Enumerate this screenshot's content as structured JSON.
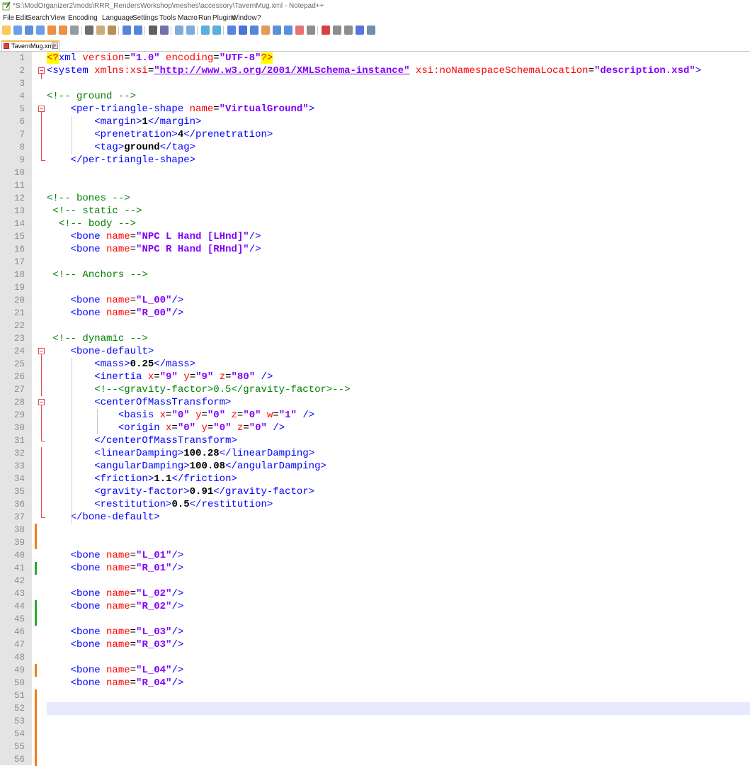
{
  "window": {
    "title": "*S:\\ModOrganizer2\\mods\\RRR_RendersWorkshop\\meshes\\accessory\\TavernMug.xml - Notepad++",
    "app_icon": "notepad-icon"
  },
  "menu": [
    "File",
    "Edit",
    "Search",
    "View",
    "Encoding",
    "Language",
    "Settings",
    "Tools",
    "Macro",
    "Run",
    "Plugins",
    "Window",
    "?"
  ],
  "toolbar": {
    "buttons": [
      "new-file-icon",
      "open-file-icon",
      "save-icon",
      "save-all-icon",
      "close-icon",
      "close-all-icon",
      "print-icon",
      "cut-icon",
      "copy-icon",
      "paste-icon",
      "undo-icon",
      "redo-icon",
      "find-icon",
      "replace-icon",
      "zoom-in-icon",
      "zoom-out-icon",
      "sync-vertical-icon",
      "sync-horizontal-icon",
      "word-wrap-icon",
      "show-all-chars-icon",
      "indent-guide-icon",
      "user-language-icon",
      "doc-map-icon",
      "function-list-icon",
      "folder-workspace-icon",
      "monitor-icon",
      "record-macro-icon",
      "stop-record-icon",
      "play-macro-icon",
      "run-macro-multiple-icon",
      "save-macro-icon"
    ]
  },
  "tabs": [
    {
      "label": "TavernMug.xml",
      "active": true,
      "modified": true
    }
  ],
  "editor": {
    "caret_line": 52,
    "line_numbers": [
      "1",
      "2",
      "3",
      "4",
      "5",
      "6",
      "7",
      "8",
      "9",
      "10",
      "11",
      "12",
      "13",
      "14",
      "15",
      "16",
      "17",
      "18",
      "19",
      "20",
      "21",
      "22",
      "23",
      "24",
      "25",
      "26",
      "27",
      "28",
      "29",
      "30",
      "31",
      "32",
      "33",
      "34",
      "35",
      "36",
      "37",
      "38",
      "39",
      "40",
      "41",
      "42",
      "43",
      "44",
      "45",
      "46",
      "47",
      "48",
      "49",
      "50",
      "51",
      "52",
      "53",
      "54",
      "55",
      "56"
    ],
    "lines": [
      [
        [
          "hl",
          "<?"
        ],
        [
          "tag",
          "xml "
        ],
        [
          "att",
          "version"
        ],
        [
          "eq",
          "="
        ],
        [
          "val",
          "\"1.0\""
        ],
        [
          "att",
          " encoding"
        ],
        [
          "eq",
          "="
        ],
        [
          "val",
          "\"UTF-8\""
        ],
        [
          "hl",
          "?>"
        ]
      ],
      [
        [
          "tag",
          "<system "
        ],
        [
          "att",
          "xmlns:xsi"
        ],
        [
          "eq",
          "="
        ],
        [
          "link",
          "\"http://www.w3.org/2001/XMLSchema-instance\""
        ],
        [
          "att",
          " xsi:noNamespaceSchemaLocation"
        ],
        [
          "eq",
          "="
        ],
        [
          "val",
          "\"description.xsd\""
        ],
        [
          "tag",
          ">"
        ]
      ],
      [],
      [
        [
          "cmt",
          "<!-- ground -->"
        ]
      ],
      [
        [
          "plain",
          "    "
        ],
        [
          "tag",
          "<per-triangle-shape "
        ],
        [
          "att",
          "name"
        ],
        [
          "eq",
          "="
        ],
        [
          "val",
          "\"VirtualGround\""
        ],
        [
          "tag",
          ">"
        ]
      ],
      [
        [
          "plain",
          "        "
        ],
        [
          "tag",
          "<margin>"
        ],
        [
          "txt",
          "1"
        ],
        [
          "tag",
          "</margin>"
        ]
      ],
      [
        [
          "plain",
          "        "
        ],
        [
          "tag",
          "<prenetration>"
        ],
        [
          "txt",
          "4"
        ],
        [
          "tag",
          "</prenetration>"
        ]
      ],
      [
        [
          "plain",
          "        "
        ],
        [
          "tag",
          "<tag>"
        ],
        [
          "txt",
          "ground"
        ],
        [
          "tag",
          "</tag>"
        ]
      ],
      [
        [
          "plain",
          "    "
        ],
        [
          "tag",
          "</per-triangle-shape>"
        ]
      ],
      [],
      [],
      [
        [
          "cmt",
          "<!-- bones -->"
        ]
      ],
      [
        [
          "plain",
          " "
        ],
        [
          "cmt",
          "<!-- static -->"
        ]
      ],
      [
        [
          "plain",
          "  "
        ],
        [
          "cmt",
          "<!-- body -->"
        ]
      ],
      [
        [
          "plain",
          "    "
        ],
        [
          "tag",
          "<bone "
        ],
        [
          "att",
          "name"
        ],
        [
          "eq",
          "="
        ],
        [
          "val",
          "\"NPC L Hand [LHnd]\""
        ],
        [
          "tag",
          "/>"
        ]
      ],
      [
        [
          "plain",
          "    "
        ],
        [
          "tag",
          "<bone "
        ],
        [
          "att",
          "name"
        ],
        [
          "eq",
          "="
        ],
        [
          "val",
          "\"NPC R Hand [RHnd]\""
        ],
        [
          "tag",
          "/>"
        ]
      ],
      [],
      [
        [
          "plain",
          " "
        ],
        [
          "cmt",
          "<!-- Anchors -->"
        ]
      ],
      [],
      [
        [
          "plain",
          "    "
        ],
        [
          "tag",
          "<bone "
        ],
        [
          "att",
          "name"
        ],
        [
          "eq",
          "="
        ],
        [
          "val",
          "\"L_00\""
        ],
        [
          "tag",
          "/>"
        ]
      ],
      [
        [
          "plain",
          "    "
        ],
        [
          "tag",
          "<bone "
        ],
        [
          "att",
          "name"
        ],
        [
          "eq",
          "="
        ],
        [
          "val",
          "\"R_00\""
        ],
        [
          "tag",
          "/>"
        ]
      ],
      [],
      [
        [
          "plain",
          " "
        ],
        [
          "cmt",
          "<!-- dynamic -->"
        ]
      ],
      [
        [
          "plain",
          "    "
        ],
        [
          "tag",
          "<bone-default>"
        ]
      ],
      [
        [
          "plain",
          "        "
        ],
        [
          "tag",
          "<mass>"
        ],
        [
          "txt",
          "0.25"
        ],
        [
          "tag",
          "</mass>"
        ]
      ],
      [
        [
          "plain",
          "        "
        ],
        [
          "tag",
          "<inertia "
        ],
        [
          "att",
          "x"
        ],
        [
          "eq",
          "="
        ],
        [
          "val",
          "\"9\""
        ],
        [
          "att",
          " y"
        ],
        [
          "eq",
          "="
        ],
        [
          "val",
          "\"9\""
        ],
        [
          "att",
          " z"
        ],
        [
          "eq",
          "="
        ],
        [
          "val",
          "\"80\""
        ],
        [
          "tag",
          " />"
        ]
      ],
      [
        [
          "plain",
          "        "
        ],
        [
          "cmt",
          "<!--<gravity-factor>0.5</gravity-factor>-->"
        ]
      ],
      [
        [
          "plain",
          "        "
        ],
        [
          "tag",
          "<centerOfMassTransform>"
        ]
      ],
      [
        [
          "plain",
          "            "
        ],
        [
          "tag",
          "<basis "
        ],
        [
          "att",
          "x"
        ],
        [
          "eq",
          "="
        ],
        [
          "val",
          "\"0\""
        ],
        [
          "att",
          " y"
        ],
        [
          "eq",
          "="
        ],
        [
          "val",
          "\"0\""
        ],
        [
          "att",
          " z"
        ],
        [
          "eq",
          "="
        ],
        [
          "val",
          "\"0\""
        ],
        [
          "att",
          " w"
        ],
        [
          "eq",
          "="
        ],
        [
          "val",
          "\"1\""
        ],
        [
          "tag",
          " />"
        ]
      ],
      [
        [
          "plain",
          "            "
        ],
        [
          "tag",
          "<origin "
        ],
        [
          "att",
          "x"
        ],
        [
          "eq",
          "="
        ],
        [
          "val",
          "\"0\""
        ],
        [
          "att",
          " y"
        ],
        [
          "eq",
          "="
        ],
        [
          "val",
          "\"0\""
        ],
        [
          "att",
          " z"
        ],
        [
          "eq",
          "="
        ],
        [
          "val",
          "\"0\""
        ],
        [
          "tag",
          " />"
        ]
      ],
      [
        [
          "plain",
          "        "
        ],
        [
          "tag",
          "</centerOfMassTransform>"
        ]
      ],
      [
        [
          "plain",
          "        "
        ],
        [
          "tag",
          "<linearDamping>"
        ],
        [
          "txt",
          "100.28"
        ],
        [
          "tag",
          "</linearDamping>"
        ]
      ],
      [
        [
          "plain",
          "        "
        ],
        [
          "tag",
          "<angularDamping>"
        ],
        [
          "txt",
          "100.08"
        ],
        [
          "tag",
          "</angularDamping>"
        ]
      ],
      [
        [
          "plain",
          "        "
        ],
        [
          "tag",
          "<friction>"
        ],
        [
          "txt",
          "1.1"
        ],
        [
          "tag",
          "</friction>"
        ]
      ],
      [
        [
          "plain",
          "        "
        ],
        [
          "tag",
          "<gravity-factor>"
        ],
        [
          "txt",
          "0.91"
        ],
        [
          "tag",
          "</gravity-factor>"
        ]
      ],
      [
        [
          "plain",
          "        "
        ],
        [
          "tag",
          "<restitution>"
        ],
        [
          "txt",
          "0.5"
        ],
        [
          "tag",
          "</restitution>"
        ]
      ],
      [
        [
          "plain",
          "    "
        ],
        [
          "tag",
          "</bone-default>"
        ]
      ],
      [],
      [],
      [
        [
          "plain",
          "    "
        ],
        [
          "tag",
          "<bone "
        ],
        [
          "att",
          "name"
        ],
        [
          "eq",
          "="
        ],
        [
          "val",
          "\"L_01\""
        ],
        [
          "tag",
          "/>"
        ]
      ],
      [
        [
          "plain",
          "    "
        ],
        [
          "tag",
          "<bone "
        ],
        [
          "att",
          "name"
        ],
        [
          "eq",
          "="
        ],
        [
          "val",
          "\"R_01\""
        ],
        [
          "tag",
          "/>"
        ]
      ],
      [],
      [
        [
          "plain",
          "    "
        ],
        [
          "tag",
          "<bone "
        ],
        [
          "att",
          "name"
        ],
        [
          "eq",
          "="
        ],
        [
          "val",
          "\"L_02\""
        ],
        [
          "tag",
          "/>"
        ]
      ],
      [
        [
          "plain",
          "    "
        ],
        [
          "tag",
          "<bone "
        ],
        [
          "att",
          "name"
        ],
        [
          "eq",
          "="
        ],
        [
          "val",
          "\"R_02\""
        ],
        [
          "tag",
          "/>"
        ]
      ],
      [],
      [
        [
          "plain",
          "    "
        ],
        [
          "tag",
          "<bone "
        ],
        [
          "att",
          "name"
        ],
        [
          "eq",
          "="
        ],
        [
          "val",
          "\"L_03\""
        ],
        [
          "tag",
          "/>"
        ]
      ],
      [
        [
          "plain",
          "    "
        ],
        [
          "tag",
          "<bone "
        ],
        [
          "att",
          "name"
        ],
        [
          "eq",
          "="
        ],
        [
          "val",
          "\"R_03\""
        ],
        [
          "tag",
          "/>"
        ]
      ],
      [],
      [
        [
          "plain",
          "    "
        ],
        [
          "tag",
          "<bone "
        ],
        [
          "att",
          "name"
        ],
        [
          "eq",
          "="
        ],
        [
          "val",
          "\"L_04\""
        ],
        [
          "tag",
          "/>"
        ]
      ],
      [
        [
          "plain",
          "    "
        ],
        [
          "tag",
          "<bone "
        ],
        [
          "att",
          "name"
        ],
        [
          "eq",
          "="
        ],
        [
          "val",
          "\"R_04\""
        ],
        [
          "tag",
          "/>"
        ]
      ],
      [],
      [],
      [],
      [],
      [],
      []
    ],
    "change_markers": {
      "38": "unsaved",
      "39": "unsaved",
      "41": "saved",
      "44": "saved",
      "45": "saved",
      "49": "unsaved",
      "51": "unsaved",
      "52": "unsaved",
      "53": "unsaved",
      "54": "unsaved",
      "55": "unsaved",
      "56": "unsaved"
    },
    "fold_markers": {
      "2": "open",
      "5": "open",
      "6": "body",
      "7": "body",
      "8": "body",
      "9": "end",
      "24": "open",
      "25": "body",
      "26": "body",
      "27": "body",
      "28": "open",
      "29": "body",
      "30": "body",
      "31": "end",
      "32": "body",
      "33": "body",
      "34": "body",
      "35": "body",
      "36": "body",
      "37": "end"
    }
  },
  "colors": {
    "tag": "#0000ff",
    "attribute": "#ff0000",
    "value": "#8000ff",
    "comment": "#008000",
    "line_number_bg": "#e4e4e4",
    "caret_line_bg": "#e8e8ff",
    "saved_change": "#2fa52f",
    "unsaved_change": "#f07d19",
    "fold": "#e24b4b"
  }
}
